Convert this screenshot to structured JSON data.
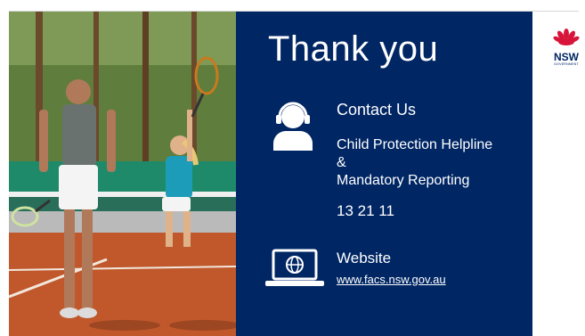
{
  "slide": {
    "title": "Thank you",
    "contact": {
      "icon": "headset-person-icon",
      "heading": "Contact Us",
      "lines": [
        "Child Protection Helpline",
        "&",
        "Mandatory Reporting"
      ],
      "phone": "13 21 11"
    },
    "website": {
      "icon": "laptop-globe-icon",
      "heading": "Website",
      "url": "www.facs.nsw.gov.au"
    },
    "logo": {
      "name": "NSW",
      "subtitle": "GOVERNMENT",
      "icon": "waratah-icon"
    },
    "photo": "father-and-daughter-tennis-court-photo"
  },
  "colors": {
    "panel": "#002664",
    "text": "#ffffff",
    "logo_red": "#d7153a"
  }
}
